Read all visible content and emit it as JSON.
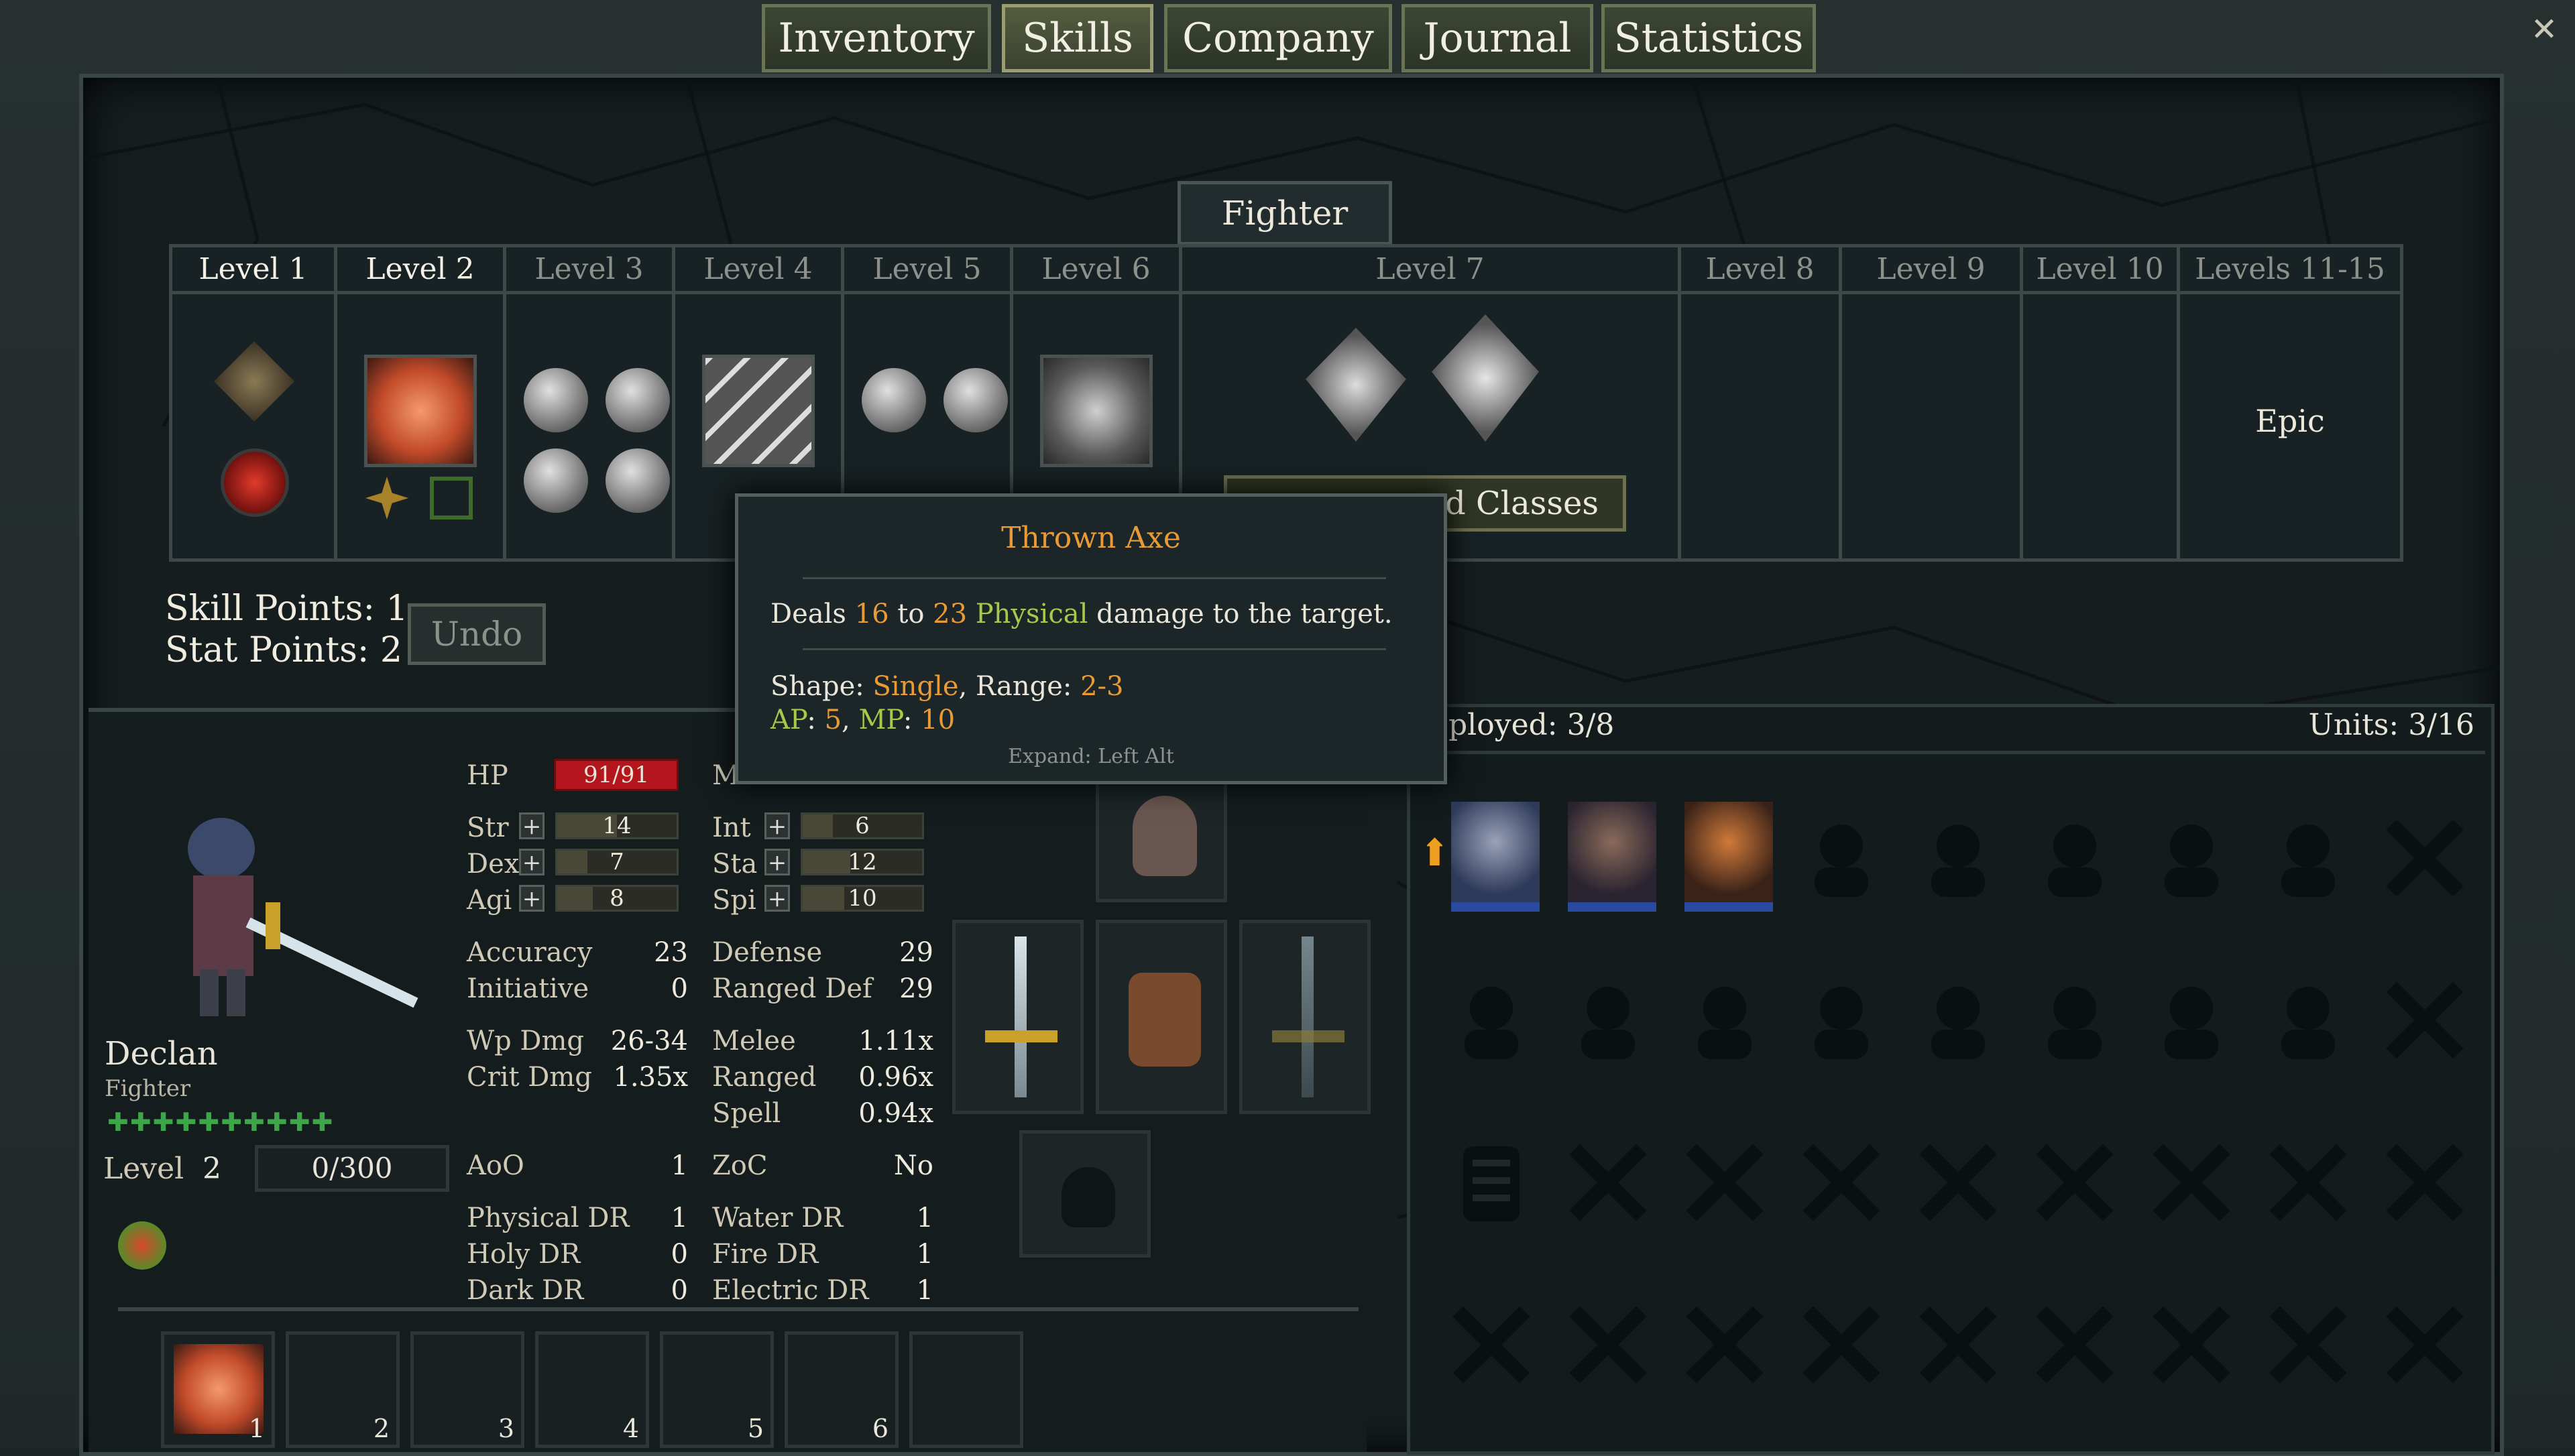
{
  "tabs": [
    "Inventory",
    "Skills",
    "Company",
    "Journal",
    "Statistics"
  ],
  "active_tab": "Skills",
  "class_name": "Fighter",
  "levels": [
    "Level 1",
    "Level 2",
    "Level 3",
    "Level 4",
    "Level 5",
    "Level 6",
    "Level 7",
    "Level 8",
    "Level 9",
    "Level 10",
    "Levels 11-15"
  ],
  "epic_label": "Epic",
  "advanced_classes_label": "d Classes",
  "points": {
    "skill": "Skill Points: 1",
    "stat": "Stat Points: 2",
    "undo": "Undo"
  },
  "tooltip": {
    "title": "Thrown Axe",
    "desc_a": "Deals ",
    "min": "16",
    "to": " to ",
    "max": "23",
    "dmg_type": " Physical",
    "desc_b": " damage to the target.",
    "shape_label": "Shape: ",
    "shape": "Single",
    "range_label": ", Range: ",
    "range": "2-3",
    "ap_label": "AP",
    "ap": "5",
    "mp_label": "MP",
    "mp": "10",
    "expand": "Expand: Left Alt"
  },
  "character": {
    "name": "Declan",
    "class": "Fighter",
    "level_label": "Level",
    "level": "2",
    "xp": "0/300",
    "hp_label": "HP",
    "hp": "91/91",
    "mp_label": "M",
    "stats_left": [
      {
        "k": "Str",
        "v": "14",
        "fill": 0.5
      },
      {
        "k": "Dex",
        "v": "7",
        "fill": 0.25
      },
      {
        "k": "Agi",
        "v": "8",
        "fill": 0.3
      }
    ],
    "stats_right": [
      {
        "k": "Int",
        "v": "6",
        "fill": 0.25
      },
      {
        "k": "Sta",
        "v": "12",
        "fill": 0.4
      },
      {
        "k": "Spi",
        "v": "10",
        "fill": 0.35
      }
    ],
    "accuracy": {
      "k": "Accuracy",
      "v": "23"
    },
    "initiative": {
      "k": "Initiative",
      "v": "0"
    },
    "defense": {
      "k": "Defense",
      "v": "29"
    },
    "ranged_def": {
      "k": "Ranged Def",
      "v": "29"
    },
    "wp_dmg": {
      "k": "Wp Dmg",
      "v": "26-34"
    },
    "crit_dmg": {
      "k": "Crit Dmg",
      "v": "1.35x"
    },
    "melee": {
      "k": "Melee",
      "v": "1.11x"
    },
    "ranged": {
      "k": "Ranged",
      "v": "0.96x"
    },
    "spell": {
      "k": "Spell",
      "v": "0.94x"
    },
    "aoo": {
      "k": "AoO",
      "v": "1"
    },
    "zoc": {
      "k": "ZoC",
      "v": "No"
    },
    "physical_dr": {
      "k": "Physical DR",
      "v": "1"
    },
    "water_dr": {
      "k": "Water DR",
      "v": "1"
    },
    "holy_dr": {
      "k": "Holy DR",
      "v": "0"
    },
    "fire_dr": {
      "k": "Fire DR",
      "v": "1"
    },
    "dark_dr": {
      "k": "Dark DR",
      "v": "0"
    },
    "electric_dr": {
      "k": "Electric DR",
      "v": "1"
    }
  },
  "hotbar": [
    "1",
    "2",
    "3",
    "4",
    "5",
    "6"
  ],
  "company": {
    "deployed": "ployed: 3/8",
    "units": "Units: 3/16"
  },
  "colors": {
    "accent_orange": "#e89a36",
    "accent_green": "#a7c94a",
    "hp_red": "#b3161c"
  }
}
